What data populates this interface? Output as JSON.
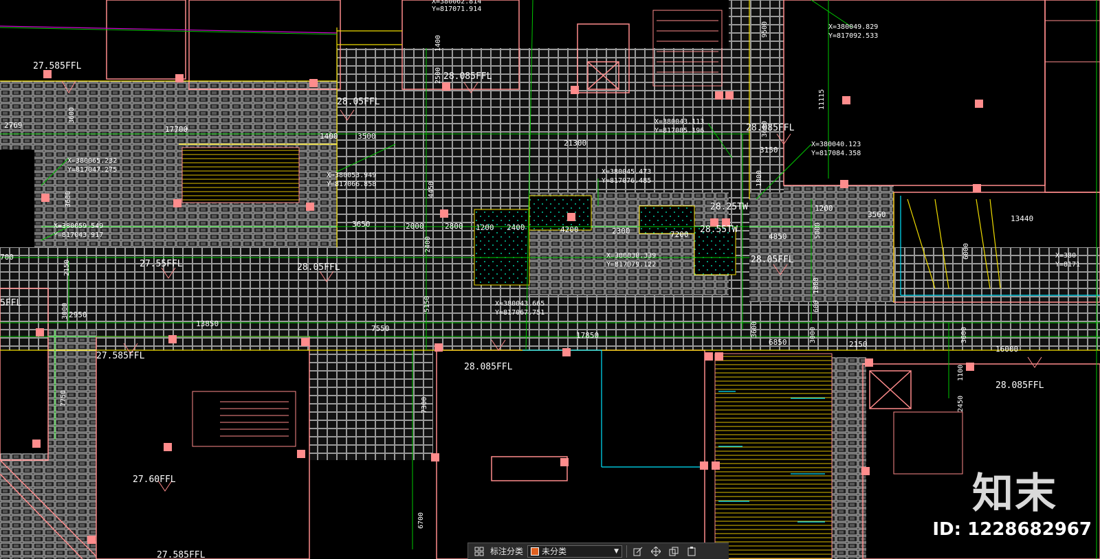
{
  "colors": {
    "background": "#000000",
    "wall": "#ff8c8c",
    "grid": "#00c800",
    "paving": "#cfcfcf",
    "yellow": "#f0dc00",
    "cyan": "#00e5ff",
    "text": "#ffffff",
    "marker": "#ff8c8c",
    "magenta": "#d000d0"
  },
  "levels": [
    {
      "text": "27.585FFL"
    },
    {
      "text": "28.05FFL"
    },
    {
      "text": "28.085FFL"
    },
    {
      "text": "28.085FFL"
    },
    {
      "text": "27.55FFL"
    },
    {
      "text": "28.05FFL"
    },
    {
      "text": "27.585FFL"
    },
    {
      "text": "28.085FFL"
    },
    {
      "text": "28.25TW"
    },
    {
      "text": "28.55TW"
    },
    {
      "text": "28.05FFL"
    },
    {
      "text": "28.085FFL"
    },
    {
      "text": "27.60FFL"
    },
    {
      "text": "27.585FFL"
    },
    {
      "text": "5FFL"
    }
  ],
  "coordinates": [
    {
      "x": "X=380065.232",
      "y": "Y=817047.275"
    },
    {
      "x": "X=380053.949",
      "y": "Y=817066.858"
    },
    {
      "x": "X=380059.549",
      "y": "Y=817043.917"
    },
    {
      "x": "X=380043.113",
      "y": "Y=817085.196"
    },
    {
      "x": "X=380045.473",
      "y": "Y=817076.485"
    },
    {
      "x": "X=380038.339",
      "y": "Y=817079.122"
    },
    {
      "x": "X=380043.665",
      "y": "Y=817067.751"
    },
    {
      "x": "X=380049.829",
      "y": "Y=817092.533"
    },
    {
      "x": "X=380040.123",
      "y": "Y=817084.358"
    },
    {
      "x": "X=380062.814",
      "y": "Y=817071.914"
    },
    {
      "x": "X=380",
      "y": "Y=8171"
    }
  ],
  "dimensions": [
    "2769",
    "17700",
    "3500",
    "1400",
    "21300",
    "3150",
    "3650",
    "2800",
    "2000",
    "1200",
    "2400",
    "4200",
    "2300",
    "7200",
    "4850",
    "1200",
    "3560",
    "13440",
    "2950",
    "13850",
    "7550",
    "17850",
    "6850",
    "2150",
    "16000",
    "700",
    "3600",
    "3600",
    "4450",
    "5150",
    "2400",
    "7750",
    "7300",
    "6700",
    "2150",
    "3000",
    "11115",
    "1800",
    "5000",
    "6000",
    "1800",
    "600",
    "3000",
    "3600",
    "2450",
    "1100",
    "3600",
    "9500",
    "2500",
    "1400",
    "3600"
  ],
  "toolbar": {
    "label": "标注分类",
    "selected": "未分类",
    "swatch_color": "#e06020"
  },
  "watermark": {
    "logo": "知末",
    "id": "ID: 1228682967"
  }
}
